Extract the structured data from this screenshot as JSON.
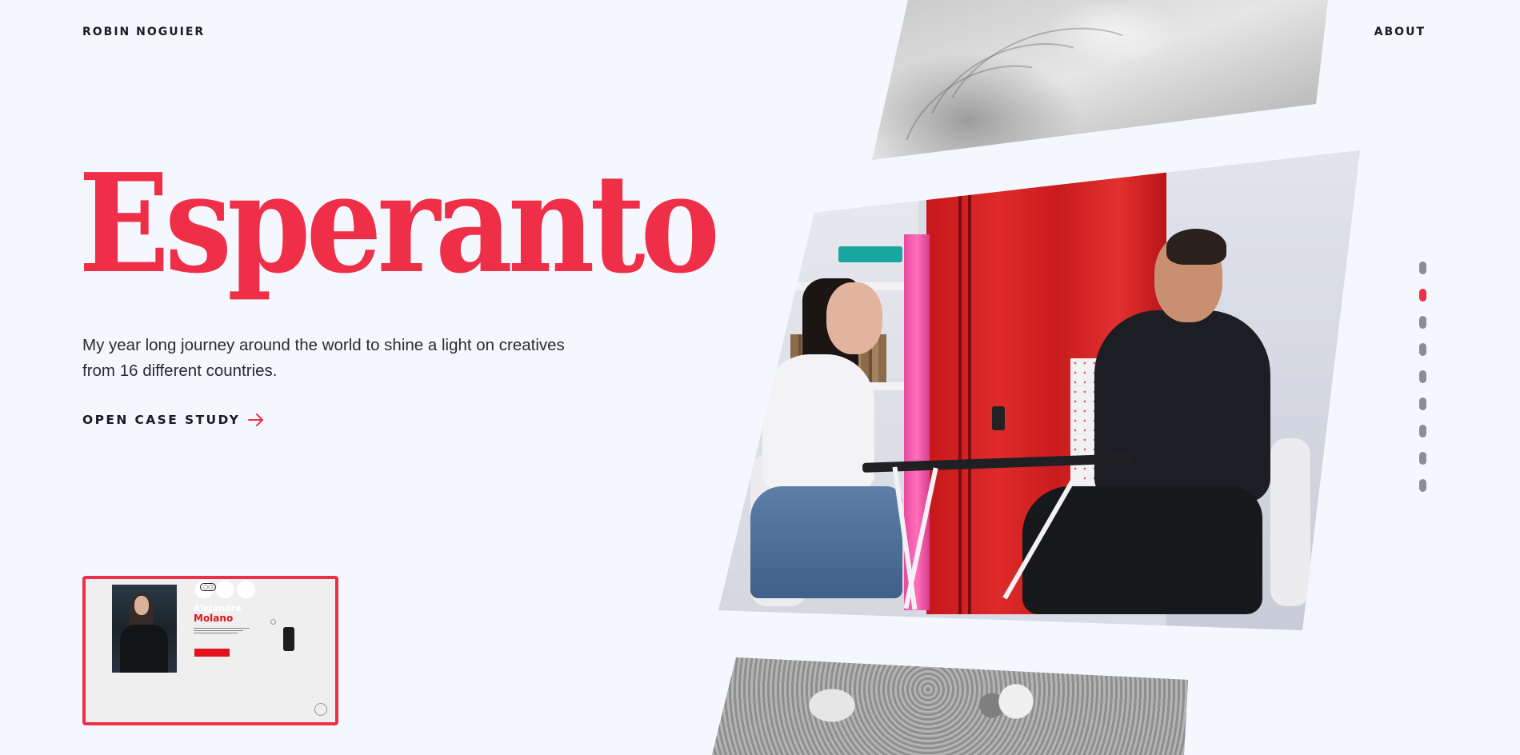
{
  "header": {
    "brand": "ROBIN NOGUIER",
    "nav_about": "ABOUT"
  },
  "hero": {
    "title": "Esperanto",
    "description": "My year long journey around the world to shine a light on creatives from 16 different countries.",
    "cta_label": "OPEN CASE STUDY",
    "cta_icon": "arrow-right-icon"
  },
  "slider": {
    "dot_count": 9,
    "active_index": 1
  },
  "next_project": {
    "name_first": "Alejandra",
    "name_last": "Molano"
  },
  "colors": {
    "accent": "#ef2f48",
    "background": "#f4f7fd",
    "text": "#1b1b1f",
    "dot_inactive": "#8d8e93"
  }
}
